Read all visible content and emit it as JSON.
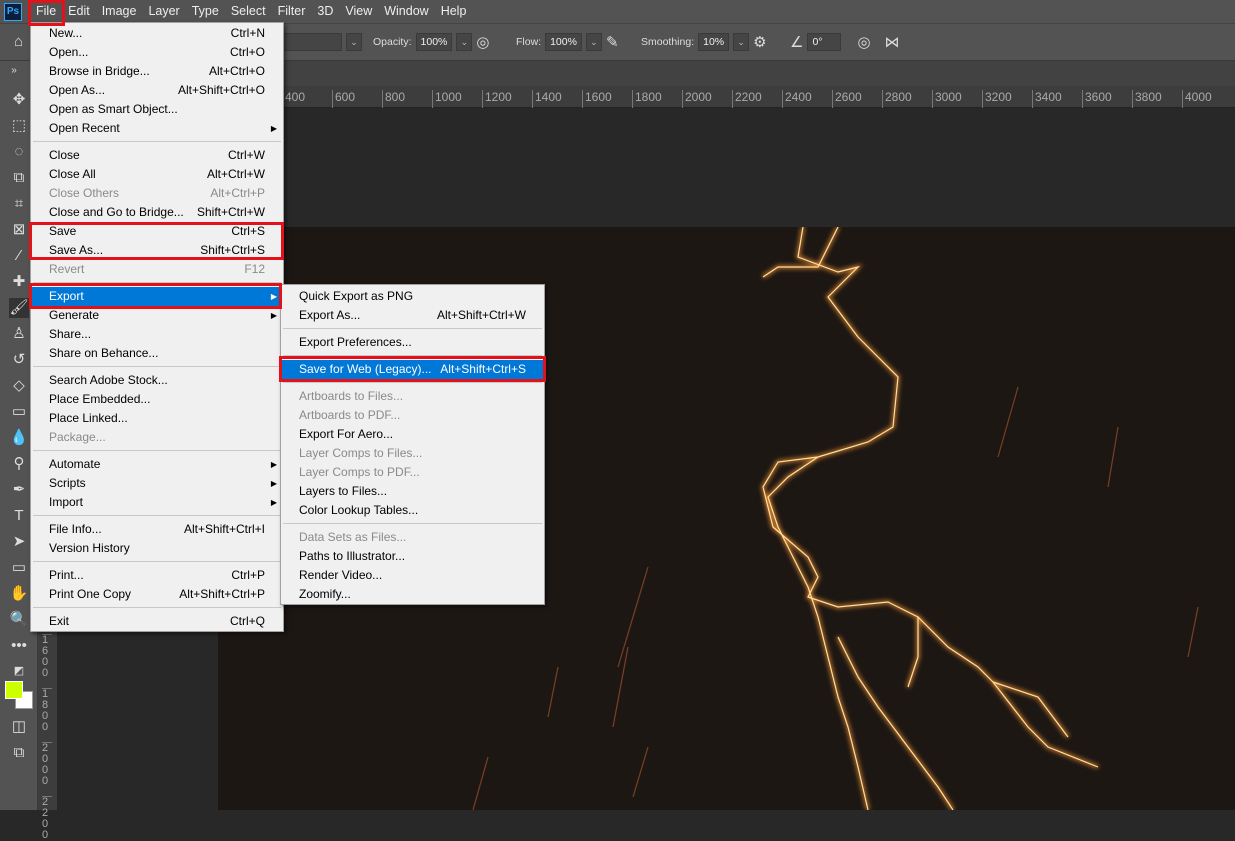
{
  "app": {
    "logo": "Ps",
    "menu": [
      "File",
      "Edit",
      "Image",
      "Layer",
      "Type",
      "Select",
      "Filter",
      "3D",
      "View",
      "Window",
      "Help"
    ]
  },
  "options": {
    "opacity_label": "Opacity:",
    "opacity": "100%",
    "flow_label": "Flow:",
    "flow": "100%",
    "smoothing_label": "Smoothing:",
    "smoothing": "10%",
    "angle": "0°"
  },
  "ruler_h": [
    "400",
    "600",
    "800",
    "1000",
    "1200",
    "1400",
    "1600",
    "1800",
    "2000",
    "2200",
    "2400",
    "2600",
    "2800",
    "3000",
    "3200",
    "3400",
    "3600",
    "3800",
    "4000"
  ],
  "ruler_v": [
    "1600",
    "1800",
    "2000",
    "2200"
  ],
  "colors": {
    "foreground": "#ccff00",
    "background": "#ffffff",
    "highlight": "#0078d7",
    "annotation": "#e3111a"
  },
  "file_menu": [
    [
      {
        "label": "New...",
        "sc": "Ctrl+N"
      },
      {
        "label": "Open...",
        "sc": "Ctrl+O"
      },
      {
        "label": "Browse in Bridge...",
        "sc": "Alt+Ctrl+O"
      },
      {
        "label": "Open As...",
        "sc": "Alt+Shift+Ctrl+O"
      },
      {
        "label": "Open as Smart Object...",
        "sc": ""
      },
      {
        "label": "Open Recent",
        "sc": "",
        "sub": true
      }
    ],
    [
      {
        "label": "Close",
        "sc": "Ctrl+W"
      },
      {
        "label": "Close All",
        "sc": "Alt+Ctrl+W"
      },
      {
        "label": "Close Others",
        "sc": "Alt+Ctrl+P",
        "dis": true
      },
      {
        "label": "Close and Go to Bridge...",
        "sc": "Shift+Ctrl+W"
      },
      {
        "label": "Save",
        "sc": "Ctrl+S"
      },
      {
        "label": "Save As...",
        "sc": "Shift+Ctrl+S"
      },
      {
        "label": "Revert",
        "sc": "F12",
        "dis": true
      }
    ],
    [
      {
        "label": "Export",
        "sc": "",
        "sub": true,
        "sel": true
      },
      {
        "label": "Generate",
        "sc": "",
        "sub": true
      },
      {
        "label": "Share...",
        "sc": ""
      },
      {
        "label": "Share on Behance...",
        "sc": ""
      }
    ],
    [
      {
        "label": "Search Adobe Stock...",
        "sc": ""
      },
      {
        "label": "Place Embedded...",
        "sc": ""
      },
      {
        "label": "Place Linked...",
        "sc": ""
      },
      {
        "label": "Package...",
        "sc": "",
        "dis": true
      }
    ],
    [
      {
        "label": "Automate",
        "sc": "",
        "sub": true
      },
      {
        "label": "Scripts",
        "sc": "",
        "sub": true
      },
      {
        "label": "Import",
        "sc": "",
        "sub": true
      }
    ],
    [
      {
        "label": "File Info...",
        "sc": "Alt+Shift+Ctrl+I"
      },
      {
        "label": "Version History",
        "sc": ""
      }
    ],
    [
      {
        "label": "Print...",
        "sc": "Ctrl+P"
      },
      {
        "label": "Print One Copy",
        "sc": "Alt+Shift+Ctrl+P"
      }
    ],
    [
      {
        "label": "Exit",
        "sc": "Ctrl+Q"
      }
    ]
  ],
  "export_menu": [
    [
      {
        "label": "Quick Export as PNG",
        "sc": ""
      },
      {
        "label": "Export As...",
        "sc": "Alt+Shift+Ctrl+W"
      }
    ],
    [
      {
        "label": "Export Preferences...",
        "sc": ""
      }
    ],
    [
      {
        "label": "Save for Web (Legacy)...",
        "sc": "Alt+Shift+Ctrl+S",
        "sel": true
      }
    ],
    [
      {
        "label": "Artboards to Files...",
        "sc": "",
        "dis": true
      },
      {
        "label": "Artboards to PDF...",
        "sc": "",
        "dis": true
      },
      {
        "label": "Export For Aero...",
        "sc": ""
      },
      {
        "label": "Layer Comps to Files...",
        "sc": "",
        "dis": true
      },
      {
        "label": "Layer Comps to PDF...",
        "sc": "",
        "dis": true
      },
      {
        "label": "Layers to Files...",
        "sc": ""
      },
      {
        "label": "Color Lookup Tables...",
        "sc": ""
      }
    ],
    [
      {
        "label": "Data Sets as Files...",
        "sc": "",
        "dis": true
      },
      {
        "label": "Paths to Illustrator...",
        "sc": ""
      },
      {
        "label": "Render Video...",
        "sc": ""
      },
      {
        "label": "Zoomify...",
        "sc": ""
      }
    ]
  ]
}
